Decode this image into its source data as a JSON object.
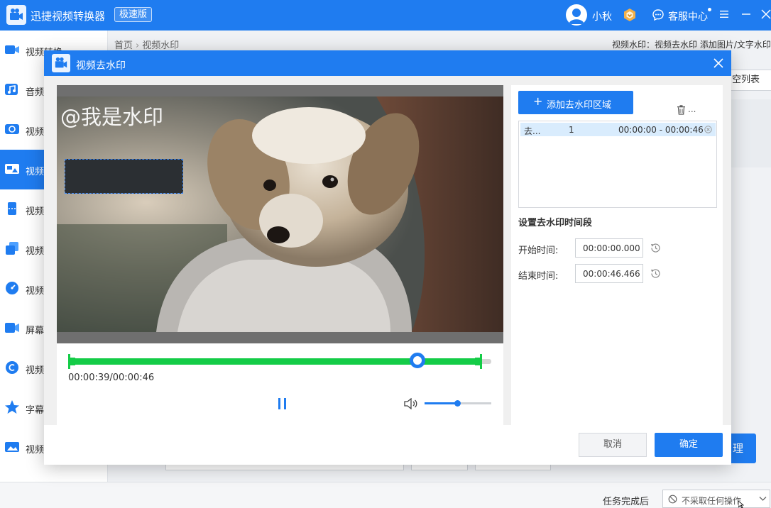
{
  "app": {
    "title": "迅捷视频转换器",
    "badge": "极速版",
    "user_name": "小秋",
    "service_label": "客服中心",
    "colors": {
      "primary": "#1f7cf0",
      "timeline": "#14cc47"
    }
  },
  "sidebar": {
    "items": [
      {
        "label": "视频转换",
        "icon": "video-convert-icon"
      },
      {
        "label": "音频",
        "icon": "audio-icon"
      },
      {
        "label": "视频",
        "icon": "video-compress-icon"
      },
      {
        "label": "视频",
        "icon": "video-watermark-icon",
        "active": true
      },
      {
        "label": "视频",
        "icon": "video-split-icon"
      },
      {
        "label": "视频",
        "icon": "video-merge-icon"
      },
      {
        "label": "视频",
        "icon": "video-speed-icon"
      },
      {
        "label": "屏幕",
        "icon": "screen-record-icon"
      },
      {
        "label": "视频",
        "icon": "video-gif-icon"
      },
      {
        "label": "字幕",
        "icon": "subtitle-icon"
      },
      {
        "label": "视频",
        "icon": "video-image-icon"
      }
    ]
  },
  "breadcrumb": {
    "home": "首页",
    "separator": "›",
    "current": "视频水印"
  },
  "top_hint": "视频水印：视频去水印 添加图片/文字水印",
  "clear_list_label": "空列表",
  "start_label": "理",
  "statusbar": {
    "task_label": "任务完成后",
    "task_option": "不采取任何操作"
  },
  "modal": {
    "title": "视频去水印",
    "player": {
      "watermark_text": "@我是水印",
      "time_current": "00:00:39",
      "time_total": "00:00:46",
      "time_readout": "00:00:39/00:00:46",
      "progress": 0.826,
      "trim_end": 0.978,
      "volume": 0.49,
      "state": "playing"
    },
    "settings": {
      "add_region_label": "添加去水印区域",
      "add_region_plus": "+",
      "trash_more": "...",
      "regions": [
        {
          "name": "去...",
          "index": "1",
          "time_range": "00:00:00  - 00:00:46"
        }
      ],
      "time_section_title": "设置去水印时间段",
      "start_label": "开始时间:",
      "start_value": "00:00:00.000",
      "end_label": "结束时间:",
      "end_value": "00:00:46.466"
    },
    "cancel_label": "取消",
    "ok_label": "确定"
  }
}
